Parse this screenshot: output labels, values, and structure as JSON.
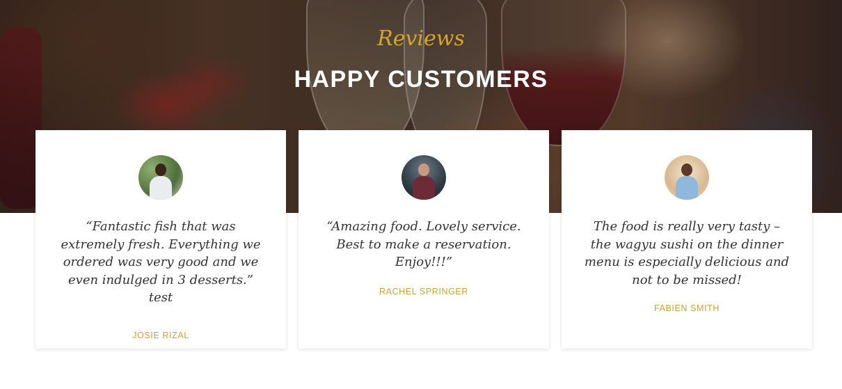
{
  "section": {
    "eyebrow": "Reviews",
    "heading": "HAPPY CUSTOMERS"
  },
  "reviews": [
    {
      "quote": "“Fantastic fish that was extremely fresh. Everything we ordered was very good and we even indulged in 3 desserts.” test",
      "name": "JOSIE RIZAL"
    },
    {
      "quote": "“Amazing food. Lovely service. Best to make a reservation. Enjoy!!!”",
      "name": "RACHEL SPRINGER"
    },
    {
      "quote": "The food is really very tasty – the wagyu sushi on the dinner menu is especially delicious and not to be missed!",
      "name": "FABIEN SMITH"
    }
  ],
  "colors": {
    "accent": "#c9a23c",
    "eyebrow": "#d4a52a",
    "heading": "#ffffff",
    "quote_text": "#333333"
  }
}
